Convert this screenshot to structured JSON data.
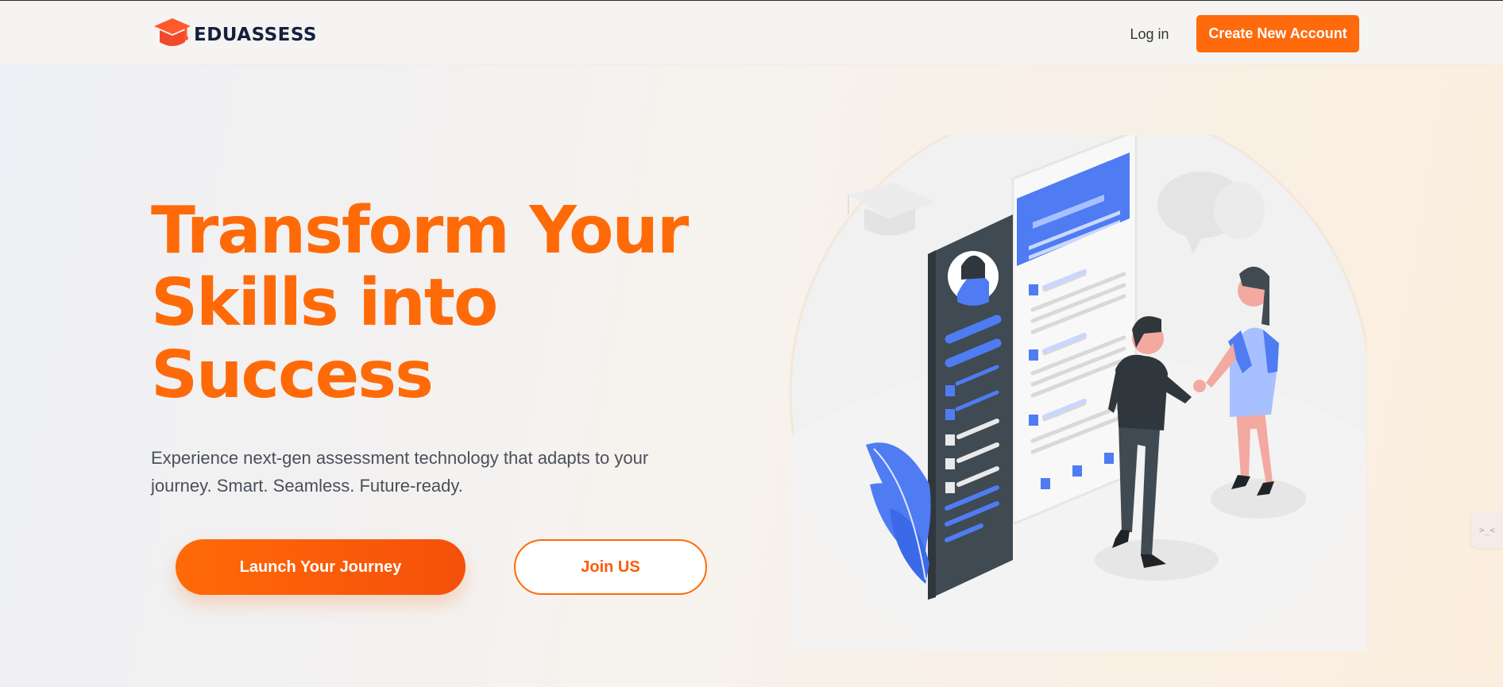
{
  "header": {
    "logo_text": "EDUASSESS",
    "logo_icon": "graduation-cap-icon",
    "login_label": "Log in",
    "create_account_label": "Create New Account"
  },
  "hero": {
    "headline_lines": [
      "Transform Your",
      "Skills into",
      "Success"
    ],
    "subtext_line1": "Experience next-gen assessment technology that adapts to your",
    "subtext_line2": "journey. Smart. Seamless. Future-ready.",
    "primary_button": "Launch Your Journey",
    "secondary_button": "Join US"
  },
  "side_tab": {
    "icon": "collapse-arrows-icon",
    "glyph": ">_<"
  },
  "colors": {
    "accent": "#ff6a08",
    "logo_text": "#14213d",
    "illustration_blue": "#4f7cf2",
    "illustration_dark": "#3f4a52"
  }
}
